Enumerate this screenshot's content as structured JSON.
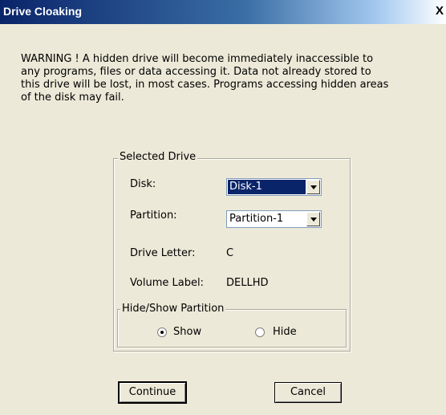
{
  "window": {
    "title": "Drive Cloaking",
    "close_label": "X"
  },
  "warning_text": "WARNING !  A hidden drive will become immediately inaccessible to\nany programs, files or data accessing it.  Data not already stored to\nthis drive will be lost, in most cases. Programs accessing hidden areas\nof the disk may fail.",
  "selected_drive": {
    "legend": "Selected Drive",
    "disk_label": "Disk:",
    "disk_value": "Disk-1",
    "partition_label": "Partition:",
    "partition_value": "Partition-1",
    "drive_letter_label": "Drive Letter:",
    "drive_letter_value": "C",
    "volume_label_label": "Volume Label:",
    "volume_label_value": "DELLHD"
  },
  "hide_show": {
    "legend": "Hide/Show Partition",
    "show_label": "Show",
    "hide_label": "Hide",
    "selected": "Show"
  },
  "buttons": {
    "continue_label": "Continue",
    "cancel_label": "Cancel"
  },
  "colors": {
    "title_bar": "#0a246a",
    "dialog_bg": "#ece9d8",
    "selection": "#0a246a"
  }
}
